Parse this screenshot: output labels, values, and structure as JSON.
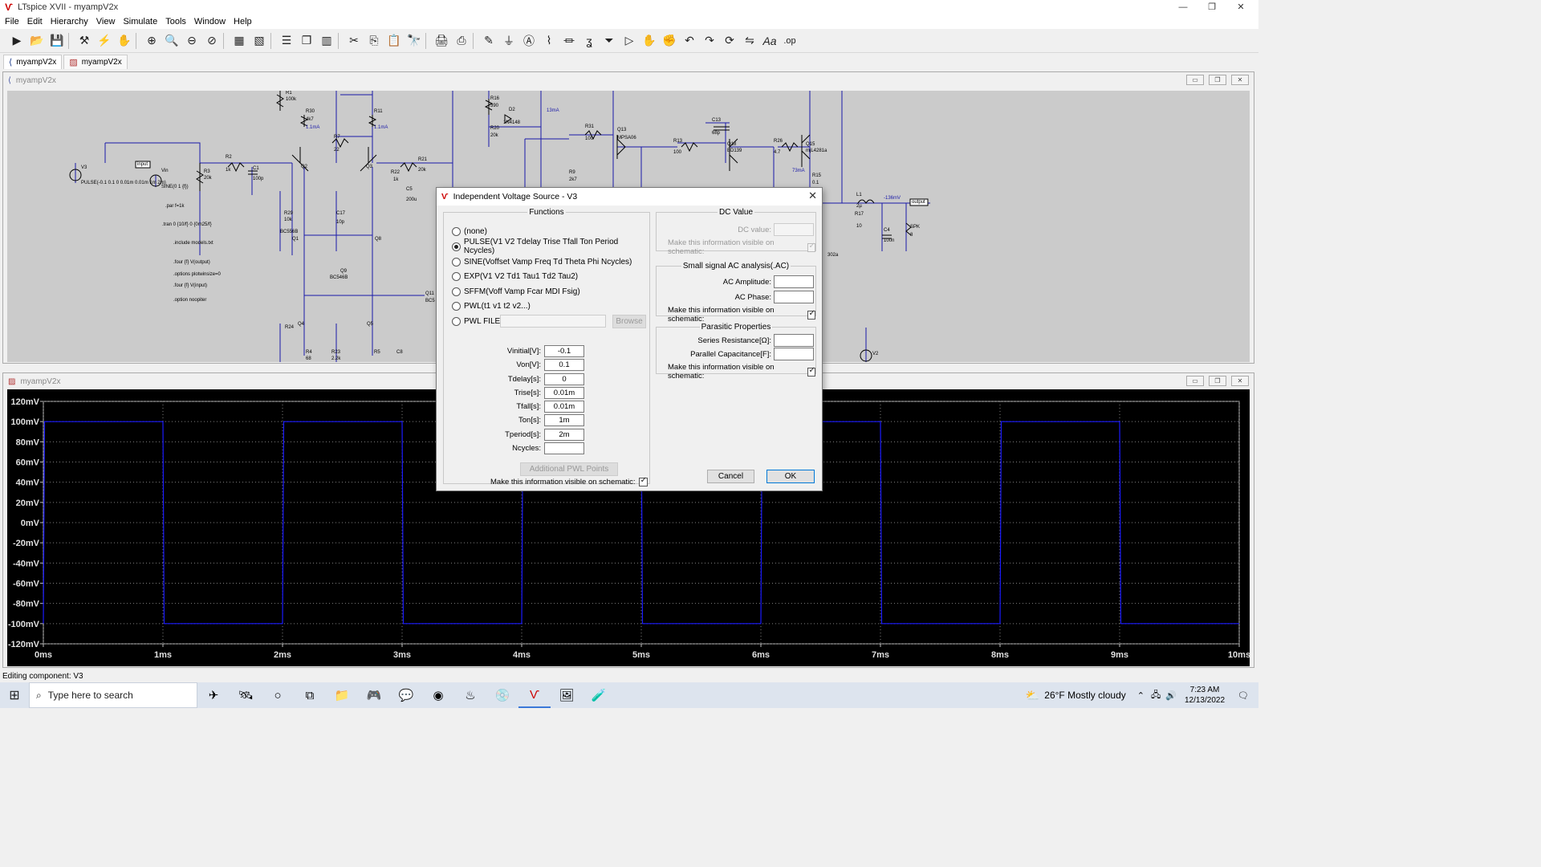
{
  "window": {
    "title": "LTspice XVII - myampV2x",
    "min": "—",
    "restore": "❐",
    "close": "✕"
  },
  "menu": [
    "File",
    "Edit",
    "Hierarchy",
    "View",
    "Simulate",
    "Tools",
    "Window",
    "Help"
  ],
  "toolbar_icons": [
    "run-icon",
    "open-icon",
    "save-icon",
    "control-panel-icon",
    "halt-icon",
    "pan-icon",
    "zoom-in-icon",
    "zoom-area-icon",
    "zoom-out-icon",
    "zoom-cancel-icon",
    "autorange-icon",
    "spectrum-icon",
    "tile-horizontal-icon",
    "cascade-icon",
    "tile-vertical-icon",
    "cut-icon",
    "copy-icon",
    "paste-icon",
    "find-icon",
    "print-icon",
    "print-preview-icon",
    "wire-icon",
    "ground-icon",
    "label-icon",
    "resistor-icon",
    "capacitor-icon",
    "inductor-icon",
    "diode-icon",
    "component-icon",
    "move-icon",
    "drag-icon",
    "undo-icon",
    "redo-icon",
    "rotate-icon",
    "mirror-icon",
    "text-icon",
    "spice-directive-icon"
  ],
  "tabs": [
    {
      "label": "myampV2x",
      "icon": "schematic-icon"
    },
    {
      "label": "myampV2x",
      "icon": "waveform-icon"
    }
  ],
  "schematic": {
    "title": "myampV2x",
    "labels": [
      "V3",
      "Vin",
      "R3",
      "20k",
      "R2",
      "1k",
      "C1",
      "100p",
      "R30",
      "4k7",
      "R11",
      "R7",
      "22",
      "R29",
      "10k",
      "C17",
      "10p",
      "Q1",
      "Q8",
      "BC556B",
      "Q2",
      "Q3",
      "R21",
      "20k",
      "R22",
      "1k",
      "C5",
      "200u",
      "Q9",
      "BC546B",
      "Q4",
      "Q5",
      "R24",
      "R4",
      "68",
      "R23",
      "2.2k",
      "R5",
      "C8",
      "R16",
      "390",
      "D2",
      "1N4148",
      "R20",
      "20k",
      "R31",
      "100",
      "Q13",
      "MPSA06",
      "R13",
      "100",
      "C13",
      "68p",
      "Q18",
      "BD139",
      "R26",
      "4.7",
      "Q15",
      "mjL4281a",
      "R15",
      "0.1",
      "R9",
      "2k7",
      "L1",
      "2µ",
      "R17",
      "10",
      "C4",
      "100n",
      "SPK",
      "8",
      "V2",
      "Q11",
      "BC5",
      "R1",
      "100k",
      "302a"
    ],
    "blue_labels": [
      "1.1mA",
      "1.1mA",
      "13mA",
      "73mA",
      "-136mV"
    ],
    "directives": [
      "PULSE(-0.1 0.1 0 0.01m 0.01m 1m 2m)",
      "SINE(0 1 {f})",
      ".par f=1k",
      ".tran 0 {10/f} 0 {0m25/f}",
      ".include models.txt",
      ".four {f} V(output)",
      ".options plotwinsize=0",
      ".four {f} V(input)",
      ".option noopiter"
    ],
    "net_labels": [
      "input",
      "output"
    ]
  },
  "waveform": {
    "title": "myampV2x",
    "y_ticks": [
      "120mV",
      "100mV",
      "80mV",
      "60mV",
      "40mV",
      "20mV",
      "0mV",
      "-20mV",
      "-40mV",
      "-60mV",
      "-80mV",
      "-100mV",
      "-120mV"
    ],
    "x_ticks": [
      "0ms",
      "1ms",
      "2ms",
      "3ms",
      "4ms",
      "5ms",
      "6ms",
      "7ms",
      "8ms",
      "9ms",
      "10ms"
    ]
  },
  "chart_data": {
    "type": "line",
    "title": "",
    "xlabel": "",
    "ylabel": "",
    "x_unit": "ms",
    "y_unit": "mV",
    "xlim": [
      0,
      10
    ],
    "ylim": [
      -120,
      120
    ],
    "series": [
      {
        "color": "#1a1aff",
        "x": [
          0,
          0.01,
          1.0,
          1.01,
          2.0,
          2.01,
          3.0,
          3.01,
          4.0,
          4.01,
          5.0,
          5.01,
          6.0,
          6.01,
          7.0,
          7.01,
          8.0,
          8.01,
          9.0,
          9.01,
          10.0
        ],
        "y": [
          -100,
          100,
          100,
          -100,
          -100,
          100,
          100,
          -100,
          -100,
          100,
          100,
          -100,
          -100,
          100,
          100,
          -100,
          -100,
          100,
          100,
          -100,
          -100
        ]
      }
    ],
    "grid": true
  },
  "dialog": {
    "title": "Independent Voltage Source - V3",
    "functions_legend": "Functions",
    "functions": [
      {
        "label": "(none)",
        "checked": false
      },
      {
        "label": "PULSE(V1 V2 Tdelay Trise Tfall Ton Period Ncycles)",
        "checked": true
      },
      {
        "label": "SINE(Voffset Vamp Freq Td Theta Phi Ncycles)",
        "checked": false
      },
      {
        "label": "EXP(V1 V2 Td1 Tau1 Td2 Tau2)",
        "checked": false
      },
      {
        "label": "SFFM(Voff Vamp Fcar MDI Fsig)",
        "checked": false
      },
      {
        "label": "PWL(t1 v1 t2 v2...)",
        "checked": false
      },
      {
        "label": "PWL FILE:",
        "checked": false
      }
    ],
    "browse_label": "Browse",
    "params": [
      {
        "label": "Vinitial[V]:",
        "value": "-0.1"
      },
      {
        "label": "Von[V]:",
        "value": "0.1"
      },
      {
        "label": "Tdelay[s]:",
        "value": "0"
      },
      {
        "label": "Trise[s]:",
        "value": "0.01m"
      },
      {
        "label": "Tfall[s]:",
        "value": "0.01m"
      },
      {
        "label": "Ton[s]:",
        "value": "1m"
      },
      {
        "label": "Tperiod[s]:",
        "value": "2m"
      },
      {
        "label": "Ncycles:",
        "value": ""
      }
    ],
    "additional_pwl_label": "Additional PWL Points",
    "visible_schematic_label": "Make this information visible on schematic:",
    "dc": {
      "legend": "DC Value",
      "label": "DC value:",
      "visible_label": "Make this information visible on schematic:"
    },
    "ac": {
      "legend": "Small signal AC analysis(.AC)",
      "amplitude_label": "AC Amplitude:",
      "phase_label": "AC Phase:",
      "visible_label": "Make this information visible on schematic:"
    },
    "parasitic": {
      "legend": "Parasitic Properties",
      "series_label": "Series Resistance[Ω]:",
      "parallel_label": "Parallel Capacitance[F]:",
      "visible_label": "Make this information visible on schematic:"
    },
    "cancel_label": "Cancel",
    "ok_label": "OK"
  },
  "status": {
    "text": "Editing component: V3"
  },
  "taskbar": {
    "search_placeholder": "Type here to search",
    "weather": "26°F  Mostly cloudy",
    "time": "7:23 AM",
    "date": "12/13/2022"
  }
}
